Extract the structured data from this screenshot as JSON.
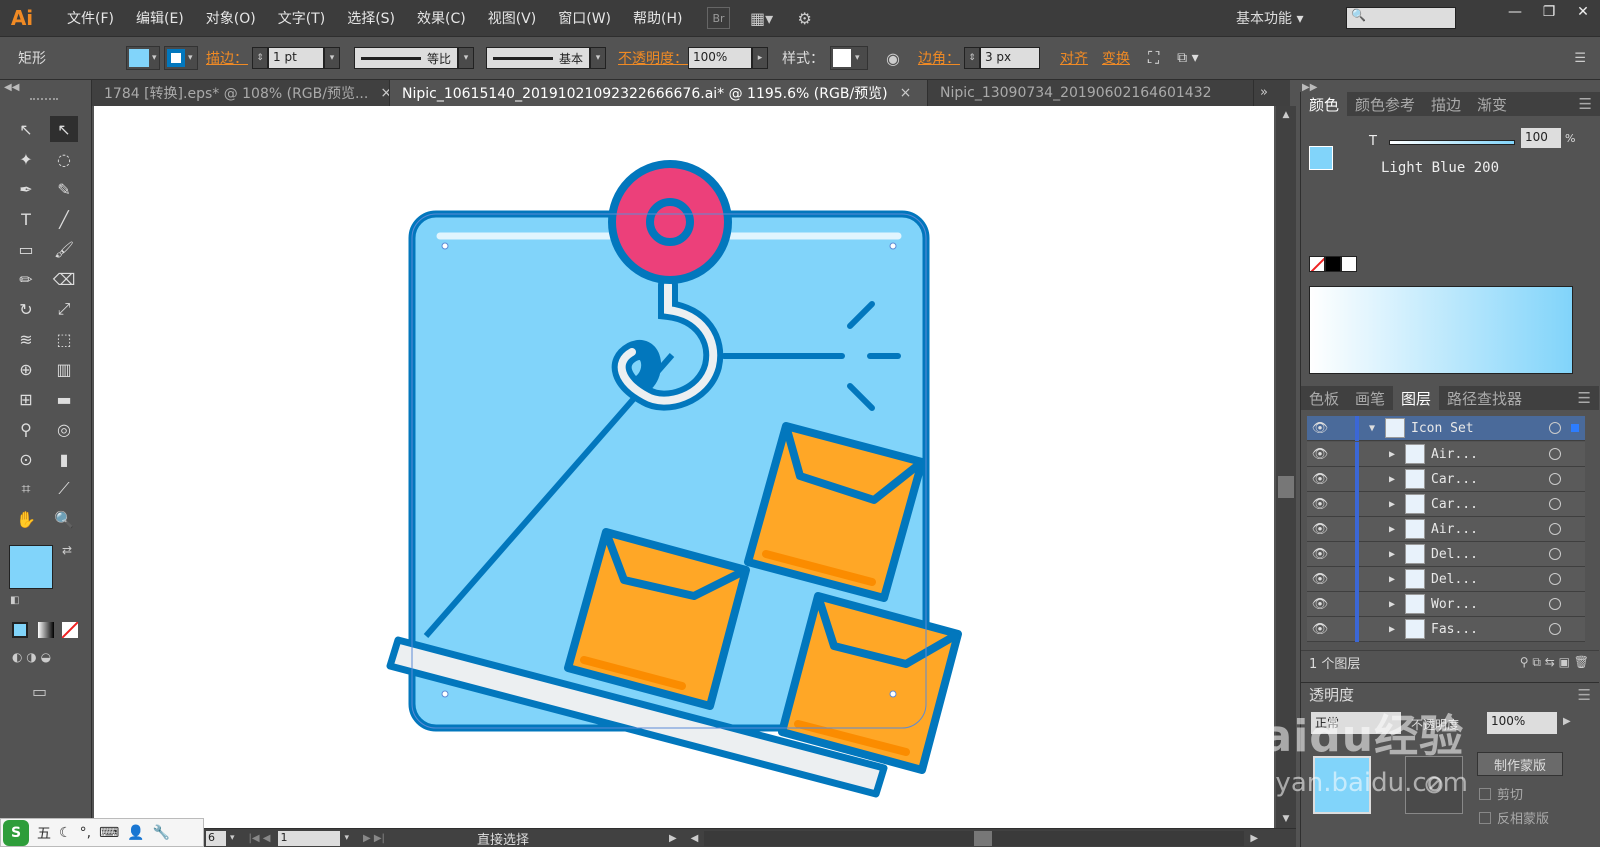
{
  "app": {
    "logo": "Ai",
    "menus": [
      "文件(F)",
      "编辑(E)",
      "对象(O)",
      "文字(T)",
      "选择(S)",
      "效果(C)",
      "视图(V)",
      "窗口(W)",
      "帮助(H)"
    ],
    "bridge": "Br",
    "workspace": "基本功能"
  },
  "control": {
    "object_type": "矩形",
    "stroke_label": "描边：",
    "stroke_value": "1 pt",
    "profile": "等比",
    "brush": "基本",
    "opacity_label": "不透明度：",
    "opacity_value": "100%",
    "style_label": "样式：",
    "corner_label": "边角：",
    "corner_value": "3 px",
    "align_label": "对齐",
    "transform_label": "变换"
  },
  "tabs": [
    {
      "label": "1784 [转换].eps* @ 108% (RGB/预览...",
      "close": "×"
    },
    {
      "label": "Nipic_10615140_20191021092322666676.ai* @ 1195.6% (RGB/预览)",
      "close": "×"
    },
    {
      "label": "Nipic_13090734_20190602164601432",
      "close": ""
    }
  ],
  "color_panel": {
    "tabs": [
      "颜色",
      "颜色参考",
      "描边",
      "渐变"
    ],
    "channel": "T",
    "value": "100",
    "unit": "%",
    "name": "Light Blue 200"
  },
  "layers_panel": {
    "tabs": [
      "色板",
      "画笔",
      "图层",
      "路径查找器"
    ],
    "layers": [
      {
        "name": "Icon Set",
        "expanded": true
      },
      {
        "name": "Air..."
      },
      {
        "name": "Car..."
      },
      {
        "name": "Car..."
      },
      {
        "name": "Air..."
      },
      {
        "name": "Del..."
      },
      {
        "name": "Del..."
      },
      {
        "name": "Wor..."
      },
      {
        "name": "Fas..."
      }
    ],
    "footer": "1 个图层"
  },
  "transparency_panel": {
    "title": "透明度",
    "mode": "正常",
    "opacity_label": "不透明度",
    "opacity": "100%",
    "make_mask": "制作蒙版",
    "clip": "剪切",
    "invert": "反相蒙版"
  },
  "status": {
    "zoom": "6",
    "page": "1",
    "tool": "直接选择"
  },
  "ime": {
    "label": "五"
  },
  "watermark": {
    "text": "Baidu经验",
    "url": "jingyan.baidu.com"
  },
  "colors": {
    "fill": "#81d4fa",
    "stroke": "#0277bd",
    "hook": "#ec407a",
    "box": "#ffa726",
    "box_stripe": "#fb8c00",
    "pallet": "#eceff1"
  }
}
